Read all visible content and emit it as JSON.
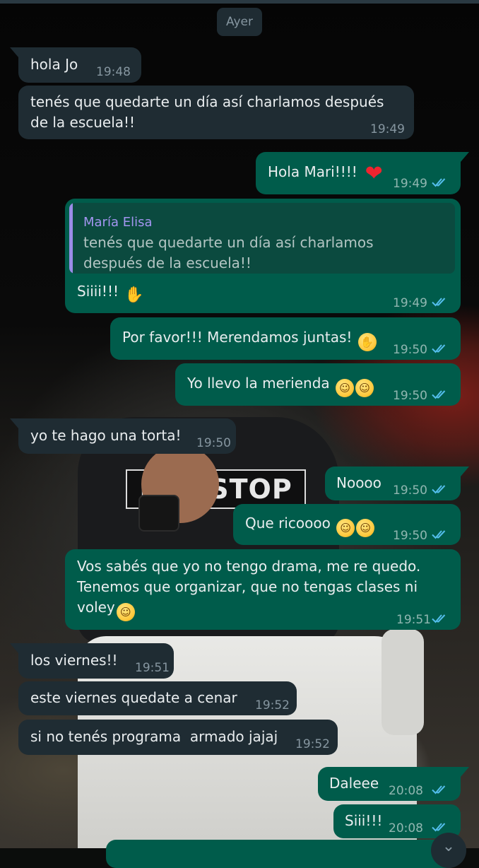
{
  "date_separator": "Ayer",
  "quoted": {
    "author": "María Elisa",
    "text": "tenés que quedarte un día así charlamos\ndespués de la escuela!!"
  },
  "messages": [
    {
      "dir": "in",
      "text": "hola Jo",
      "time": "19:48"
    },
    {
      "dir": "in",
      "text": "tenés que quedarte un día así charlamos después\nde la escuela!!",
      "time": "19:49"
    },
    {
      "dir": "out",
      "text": "Hola Mari!!!!",
      "emoji": "red-heart",
      "time": "19:49",
      "status": "read"
    },
    {
      "dir": "out",
      "text": "Siiii!!!",
      "emoji": "folded-hands",
      "time": "19:49",
      "status": "read"
    },
    {
      "dir": "out",
      "text": "Por favor!!! Merendamos juntas!",
      "emoji": "hand-over-mouth",
      "time": "19:50",
      "status": "read"
    },
    {
      "dir": "out",
      "text": "Yo llevo la merienda",
      "emoji": "grinning-sweat, beaming-grin",
      "time": "19:50",
      "status": "read"
    },
    {
      "dir": "in",
      "text": "yo te hago una torta!",
      "time": "19:50"
    },
    {
      "dir": "out",
      "text": "Noooo",
      "time": "19:50",
      "status": "read"
    },
    {
      "dir": "out",
      "text": "Que ricoooo",
      "emoji": "hand-over-mouth, smiling-hearts",
      "time": "19:50",
      "status": "read"
    },
    {
      "dir": "out",
      "text": "Vos sabés que yo no tengo drama, me re quedo.\nTenemos que organizar, que no tengas clases ni\nvoley",
      "emoji": "grinning-sweat",
      "time": "19:51",
      "status": "read"
    },
    {
      "dir": "in",
      "text": "los viernes!!",
      "time": "19:51"
    },
    {
      "dir": "in",
      "text": "este viernes quedate a cenar",
      "time": "19:52"
    },
    {
      "dir": "in",
      "text": "si no tenés programa  armado jajaj",
      "time": "19:52"
    },
    {
      "dir": "out",
      "text": "Daleee",
      "time": "20:08",
      "status": "read"
    },
    {
      "dir": "out",
      "text": "Siii!!!",
      "time": "20:08",
      "status": "read"
    }
  ],
  "wallpaper": {
    "shirt_text": "NONSTOP"
  },
  "colors": {
    "incoming_bubble": "#1f2c33",
    "outgoing_bubble": "#005c4b",
    "read_ticks": "#53bdeb",
    "quote_author": "#a395f0"
  },
  "icons": {
    "read_receipt": "double-check-icon",
    "scroll": "chevron-down-icon"
  }
}
